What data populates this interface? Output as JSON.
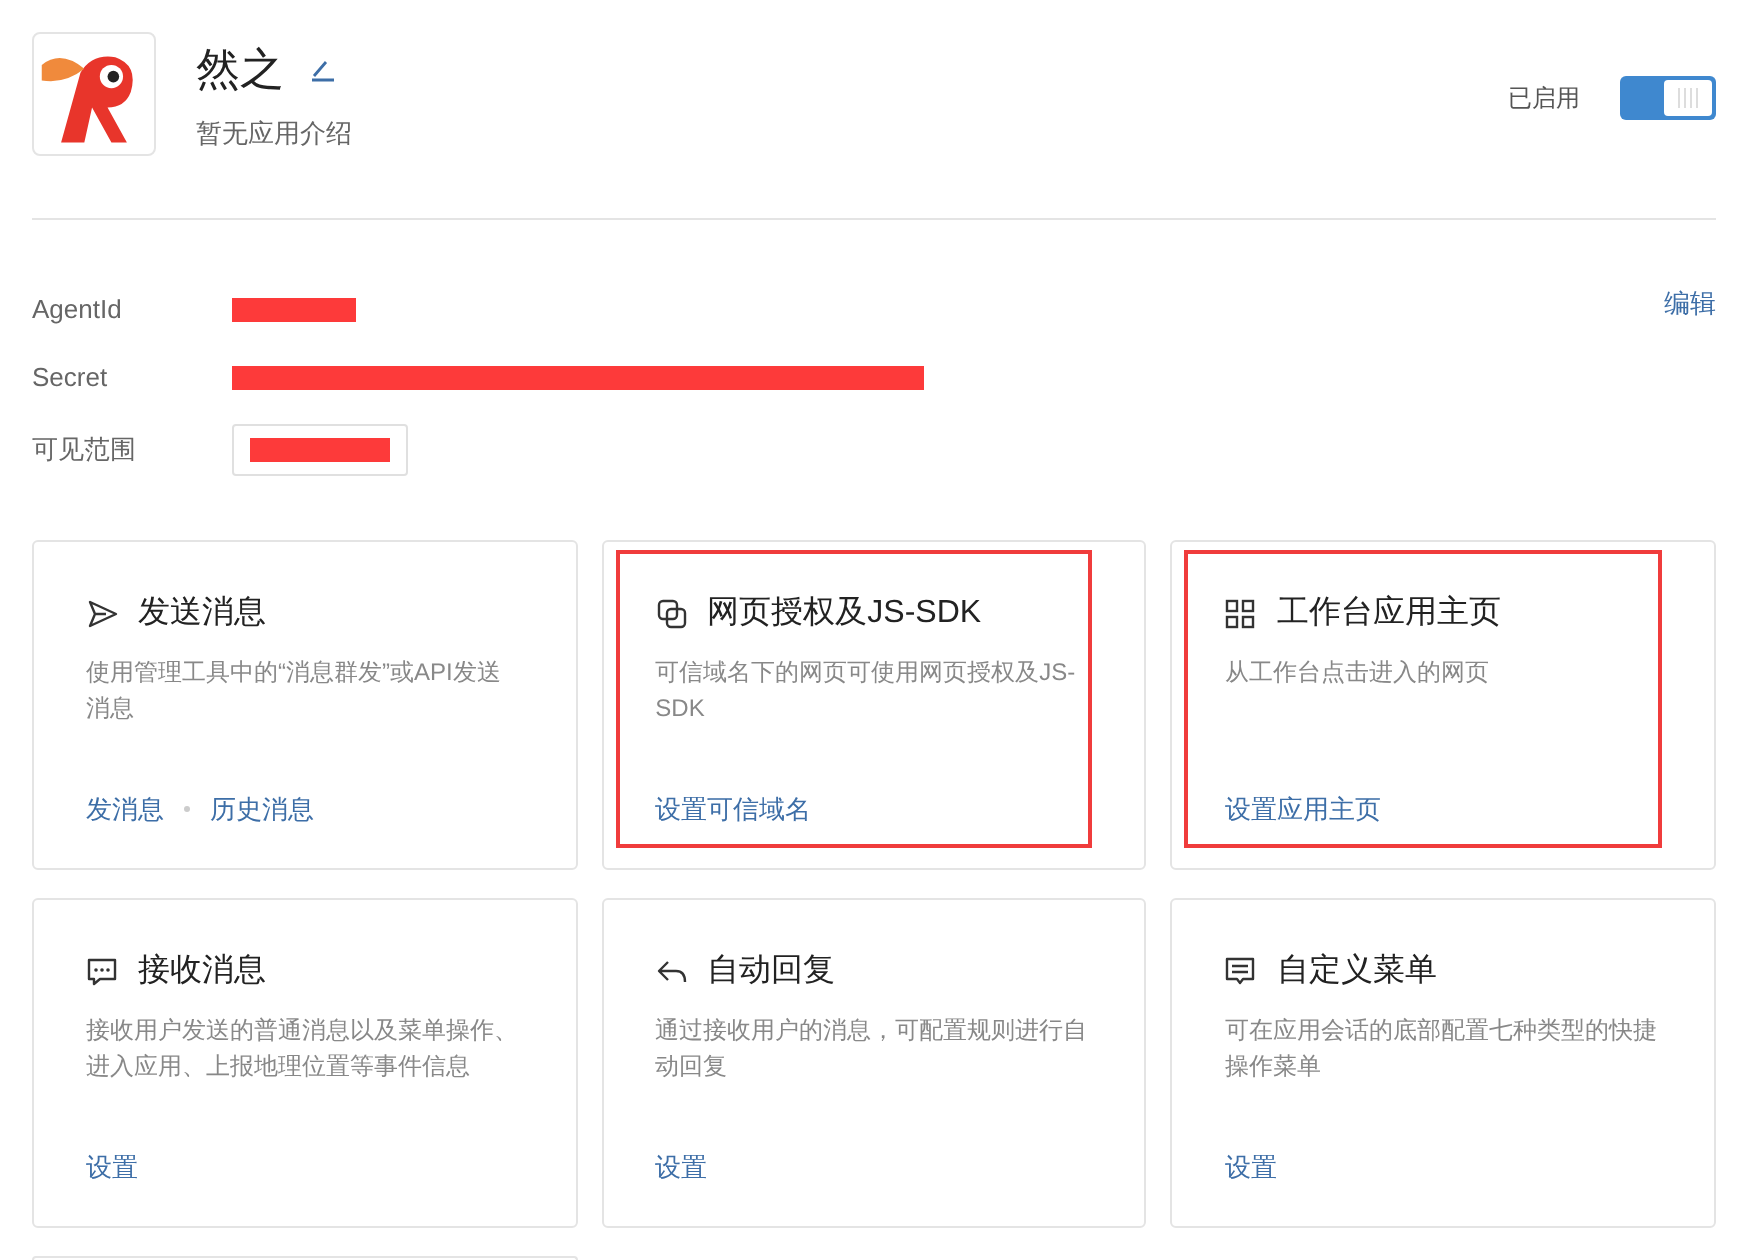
{
  "app": {
    "name": "然之",
    "description": "暂无应用介绍",
    "status_label": "已启用",
    "enabled": true
  },
  "details": {
    "edit_link": "编辑",
    "fields": [
      {
        "label": "AgentId",
        "kind": "plain",
        "redacted": true
      },
      {
        "label": "Secret",
        "kind": "plain",
        "redacted": true
      },
      {
        "label": "可见范围",
        "kind": "boxed",
        "redacted": true
      }
    ]
  },
  "cards": [
    {
      "kind": "send",
      "title": "发送消息",
      "description": "使用管理工具中的“消息群发”或API发送消息",
      "links": [
        "发消息",
        "历史消息"
      ],
      "highlighted": false
    },
    {
      "kind": "pages",
      "title": "网页授权及JS-SDK",
      "description": "可信域名下的网页可使用网页授权及JS-SDK",
      "links": [
        "设置可信域名"
      ],
      "highlighted": true
    },
    {
      "kind": "grid",
      "title": "工作台应用主页",
      "description": "从工作台点击进入的网页",
      "links": [
        "设置应用主页"
      ],
      "highlighted": true
    },
    {
      "kind": "chat",
      "title": "接收消息",
      "description": "接收用户发送的普通消息以及菜单操作、进入应用、上报地理位置等事件信息",
      "links": [
        "设置"
      ],
      "highlighted": false
    },
    {
      "kind": "reply",
      "title": "自动回复",
      "description": "通过接收用户的消息，可配置规则进行自动回复",
      "links": [
        "设置"
      ],
      "highlighted": false
    },
    {
      "kind": "menu",
      "title": "自定义菜单",
      "description": "可在应用会话的底部配置七种类型的快捷操作菜单",
      "links": [
        "设置"
      ],
      "highlighted": false
    }
  ],
  "more_cards_below": true
}
